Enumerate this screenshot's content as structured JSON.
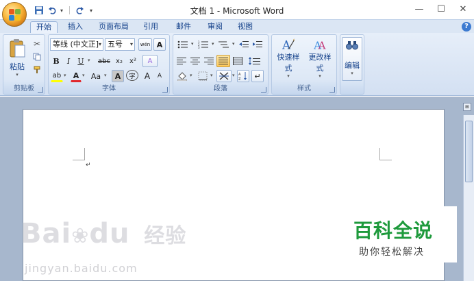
{
  "window": {
    "title": "文档 1 - Microsoft Word",
    "controls": {
      "minimize": "—",
      "maximize": "☐",
      "close": "✕"
    }
  },
  "quick_access": {
    "icons": [
      "save-icon",
      "undo-icon",
      "redo-icon",
      "customize-icon"
    ]
  },
  "tabs": [
    "开始",
    "插入",
    "页面布局",
    "引用",
    "邮件",
    "审阅",
    "视图"
  ],
  "active_tab": "开始",
  "ribbon": {
    "clipboard": {
      "label": "剪贴板",
      "paste": "粘贴"
    },
    "font": {
      "label": "字体",
      "font_name": "等线 (中文正]",
      "font_size": "五号",
      "bold": "B",
      "italic": "I",
      "underline": "U",
      "strike": "abc",
      "subscript": "x₂",
      "superscript": "x²",
      "highlight": "ab",
      "font_color": "A",
      "change_case": "Aa",
      "char_shading": "A",
      "enclose": "字",
      "grow": "A",
      "shrink": "A",
      "phonetic": "wén",
      "char_border": "A",
      "clear": "A"
    },
    "paragraph": {
      "label": "段落"
    },
    "styles": {
      "label": "样式",
      "quick_styles": "快速样式",
      "change_styles": "更改样式"
    },
    "editing": {
      "label": "编辑"
    }
  },
  "document": {
    "paragraph_mark": "↵"
  },
  "watermark": {
    "baidu": "Bai",
    "baidu2": "du",
    "baidu_cn": "经验",
    "url": "jingyan.baidu.com",
    "brand_main": "百科全说",
    "brand_sub": "助你轻松解决"
  },
  "colors": {
    "ribbon_bg": "#dbe6f4",
    "accent_text": "#15428b",
    "brand_green": "#1e9a3c"
  }
}
